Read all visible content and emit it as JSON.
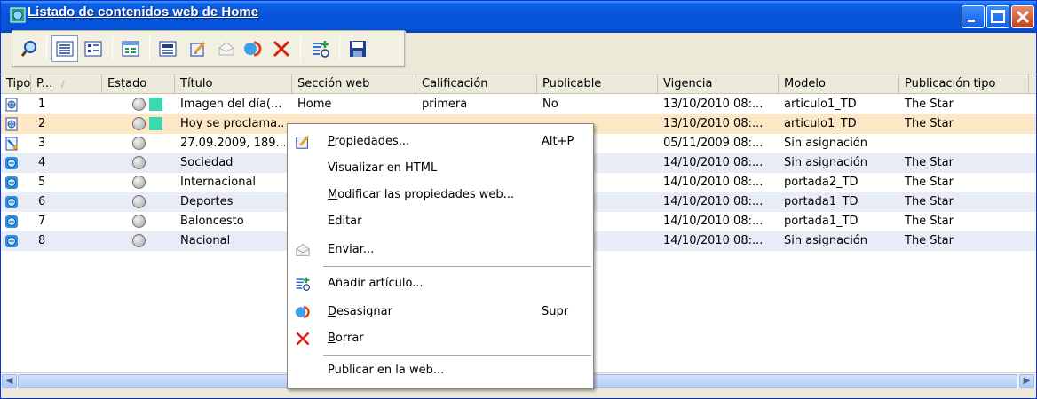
{
  "window": {
    "title": "Listado de contenidos web de Home",
    "colors": {
      "title_bar": "#0553d9",
      "selected_row": "#fde7c4",
      "shaded_row": "#e8ecf7",
      "status_square": "#3cd8b0"
    }
  },
  "toolbar": {
    "buttons": [
      {
        "icon": "search-icon"
      },
      {
        "icon": "list-view-icon"
      },
      {
        "icon": "detail-view-icon"
      },
      {
        "icon": "grid-view-icon"
      },
      {
        "icon": "preview-icon"
      },
      {
        "icon": "edit-properties-icon"
      },
      {
        "icon": "send-icon"
      },
      {
        "icon": "unassign-icon"
      },
      {
        "icon": "delete-icon"
      },
      {
        "icon": "add-article-icon"
      },
      {
        "icon": "save-icon"
      }
    ]
  },
  "table": {
    "columns": [
      "Tipo",
      "P...",
      "Estado",
      "Título",
      "Sección web",
      "Calificación",
      "Publicable",
      "Vigencia",
      "Modelo",
      "Publicación tipo"
    ],
    "rows": [
      {
        "tipo_icon": "article-globe-icon",
        "p": "1",
        "status_square": true,
        "titulo": "Imagen del día(...",
        "seccion": "Home",
        "calificacion": "primera",
        "publicable": "No",
        "vigencia": "13/10/2010 08:...",
        "modelo": "articulo1_TD",
        "pub_tipo": "The Star"
      },
      {
        "tipo_icon": "article-globe-icon",
        "p": "2",
        "status_square": true,
        "titulo": "Hoy se proclama...",
        "seccion": "",
        "calificacion": "",
        "publicable": "",
        "vigencia": "13/10/2010 08:...",
        "modelo": "articulo1_TD",
        "pub_tipo": "The Star"
      },
      {
        "tipo_icon": "link-page-icon",
        "p": "3",
        "status_square": false,
        "titulo": "27.09.2009, 189...",
        "seccion": "",
        "calificacion": "",
        "publicable": "",
        "vigencia": "05/11/2009 08:...",
        "modelo": "Sin asignación",
        "pub_tipo": ""
      },
      {
        "tipo_icon": "section-icon",
        "p": "4",
        "status_square": false,
        "titulo": "Sociedad",
        "seccion": "",
        "calificacion": "",
        "publicable": "",
        "vigencia": "14/10/2010 08:...",
        "modelo": "Sin asignación",
        "pub_tipo": "The Star"
      },
      {
        "tipo_icon": "section-icon",
        "p": "5",
        "status_square": false,
        "titulo": "Internacional",
        "seccion": "",
        "calificacion": "",
        "publicable": "",
        "vigencia": "14/10/2010 08:...",
        "modelo": "portada2_TD",
        "pub_tipo": "The Star"
      },
      {
        "tipo_icon": "section-icon",
        "p": "6",
        "status_square": false,
        "titulo": "Deportes",
        "seccion": "",
        "calificacion": "",
        "publicable": "",
        "vigencia": "14/10/2010 08:...",
        "modelo": "portada1_TD",
        "pub_tipo": "The Star"
      },
      {
        "tipo_icon": "section-icon",
        "p": "7",
        "status_square": false,
        "titulo": "Baloncesto",
        "seccion": "",
        "calificacion": "",
        "publicable": "",
        "vigencia": "14/10/2010 08:...",
        "modelo": "portada1_TD",
        "pub_tipo": "The Star"
      },
      {
        "tipo_icon": "section-icon",
        "p": "8",
        "status_square": false,
        "titulo": "Nacional",
        "seccion": "",
        "calificacion": "",
        "publicable": "",
        "vigencia": "14/10/2010 08:...",
        "modelo": "Sin asignación",
        "pub_tipo": "The Star"
      }
    ]
  },
  "context_menu": {
    "items": [
      {
        "label_u": "P",
        "label_rest": "ropiedades...",
        "shortcut": "Alt+P",
        "icon": "edit-properties-icon"
      },
      {
        "label_u": "",
        "label_rest": "Visualizar en HTML",
        "shortcut": "",
        "icon": ""
      },
      {
        "label_u": "M",
        "label_rest": "odificar las propiedades web...",
        "shortcut": "",
        "icon": ""
      },
      {
        "label_u": "",
        "label_rest": "Editar",
        "shortcut": "",
        "icon": ""
      },
      {
        "label_u": "",
        "label_rest": "Enviar...",
        "shortcut": "",
        "icon": "send-icon"
      },
      {
        "label_u": "",
        "label_rest": "Añadir artículo...",
        "shortcut": "",
        "icon": "add-article-icon"
      },
      {
        "label_u": "D",
        "label_rest": "esasignar",
        "shortcut": "Supr",
        "icon": "unassign-icon"
      },
      {
        "label_u": "B",
        "label_rest": "orrar",
        "shortcut": "",
        "icon": "delete-icon"
      },
      {
        "label_u": "",
        "label_rest": "Publicar en la web...",
        "shortcut": "",
        "icon": ""
      }
    ]
  }
}
